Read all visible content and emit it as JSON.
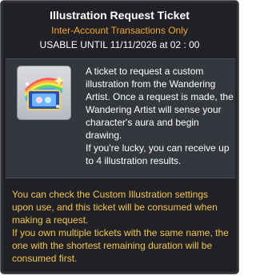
{
  "item": {
    "title": "Illustration Request Ticket",
    "trade_restriction": "Inter-Account Transactions Only",
    "expiry": "USABLE UNTIL 11/11/2026 at 02 : 00",
    "icon": "illustration-ticket-icon",
    "description_lines": [
      "A ticket to request a custom",
      "illustration from the Wandering",
      "Artist. Once a request is made, the",
      "Wandering Artist will sense your",
      "character's aura and begin",
      "drawing.",
      "If you're lucky, you can receive up",
      "to 4 illustration results."
    ],
    "note_lines": [
      "You can check the Custom Illustration settings",
      " upon use, and this ticket will be consumed when",
      " making a request.",
      "If you own multiple tickets with the same name, the",
      " one with the shortest remaining duration will be",
      " consumed first."
    ]
  },
  "colors": {
    "background": "#1f2126",
    "accent_orange": "#f5a623",
    "note_yellow": "#f5c542"
  }
}
